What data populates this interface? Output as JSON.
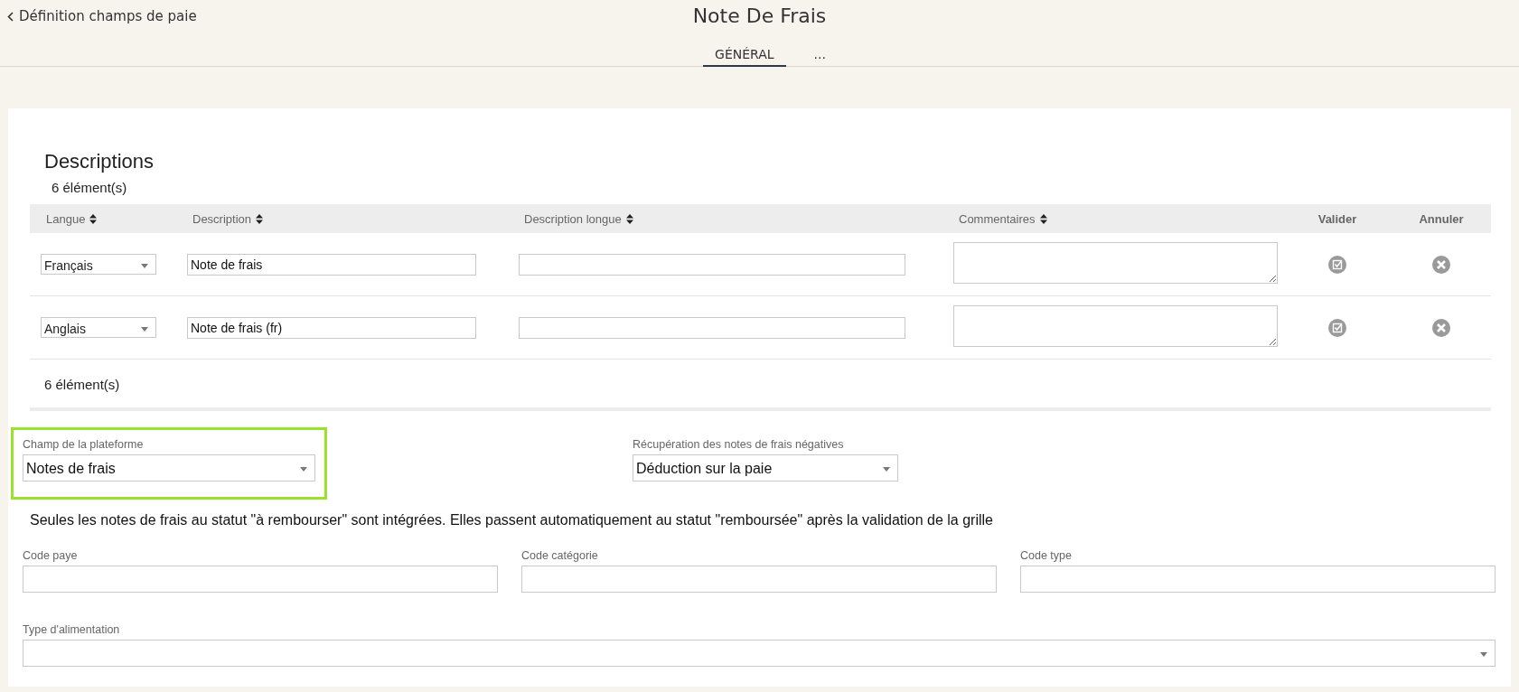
{
  "header": {
    "back_link": "Définition champs de paie",
    "title": "Note De Frais"
  },
  "tabs": [
    {
      "label": "GÉNÉRAL",
      "selected": true
    },
    {
      "label": "...",
      "selected": false
    }
  ],
  "descriptions": {
    "title": "Descriptions",
    "count_top": "6 élément(s)",
    "columns": [
      {
        "label": "Langue",
        "sortable": true
      },
      {
        "label": "Description",
        "sortable": true
      },
      {
        "label": "Description longue",
        "sortable": true
      },
      {
        "label": "Commentaires",
        "sortable": true
      },
      {
        "label": "Valider",
        "sortable": false
      },
      {
        "label": "Annuler",
        "sortable": false
      }
    ],
    "rows": [
      {
        "language": "Français",
        "description": "Note de frais"
      },
      {
        "language": "Anglais",
        "description": "Note de frais (fr)"
      }
    ],
    "count_bottom": "6 élément(s)"
  },
  "settings": [
    {
      "kind": "select",
      "label": "Champ de la plateforme",
      "value": "Notes de frais",
      "highlighted": true
    },
    {
      "kind": "select",
      "label": "Récupération des notes de frais négatives",
      "value": "Déduction sur la paie",
      "highlighted": false
    }
  ],
  "note": "Seules les notes de frais au statut \"à rembourser\" sont intégrées. Elles passent automatiquement au statut \"remboursée\" après la validation de la grille",
  "codes": [
    {
      "kind": "text",
      "label": "Code paye"
    },
    {
      "kind": "text",
      "label": "Code catégorie"
    },
    {
      "kind": "text",
      "label": "Code type"
    }
  ],
  "feed": [
    {
      "kind": "select",
      "label": "Type d'alimentation"
    }
  ]
}
